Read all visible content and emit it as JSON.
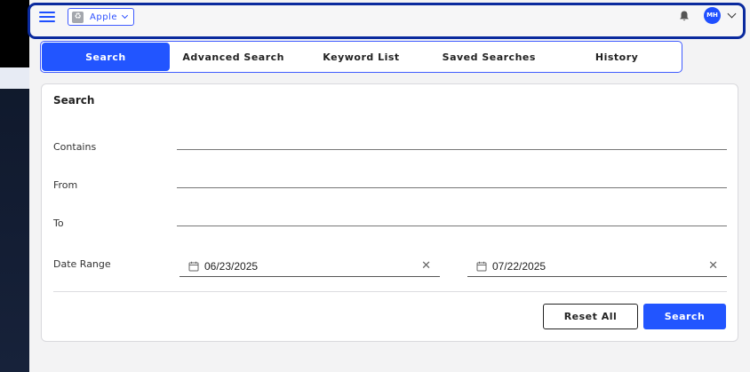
{
  "header": {
    "org_name": "Apple",
    "avatar_initials": "MH",
    "menu_icon": "hamburger-icon",
    "bell_icon": "bell-icon"
  },
  "tabs": [
    {
      "label": "Search",
      "active": true
    },
    {
      "label": "Advanced Search",
      "active": false
    },
    {
      "label": "Keyword List",
      "active": false
    },
    {
      "label": "Saved Searches",
      "active": false
    },
    {
      "label": "History",
      "active": false
    }
  ],
  "form": {
    "title": "Search",
    "contains_label": "Contains",
    "contains_value": "",
    "from_label": "From",
    "from_value": "",
    "to_label": "To",
    "to_value": "",
    "date_range_label": "Date Range",
    "date_start": "06/23/2025",
    "date_end": "07/22/2025"
  },
  "buttons": {
    "reset_label": "Reset All",
    "search_label": "Search"
  },
  "colors": {
    "accent": "#2255ff",
    "header_border": "#0a2a9e",
    "sidebar": "#131d33"
  }
}
